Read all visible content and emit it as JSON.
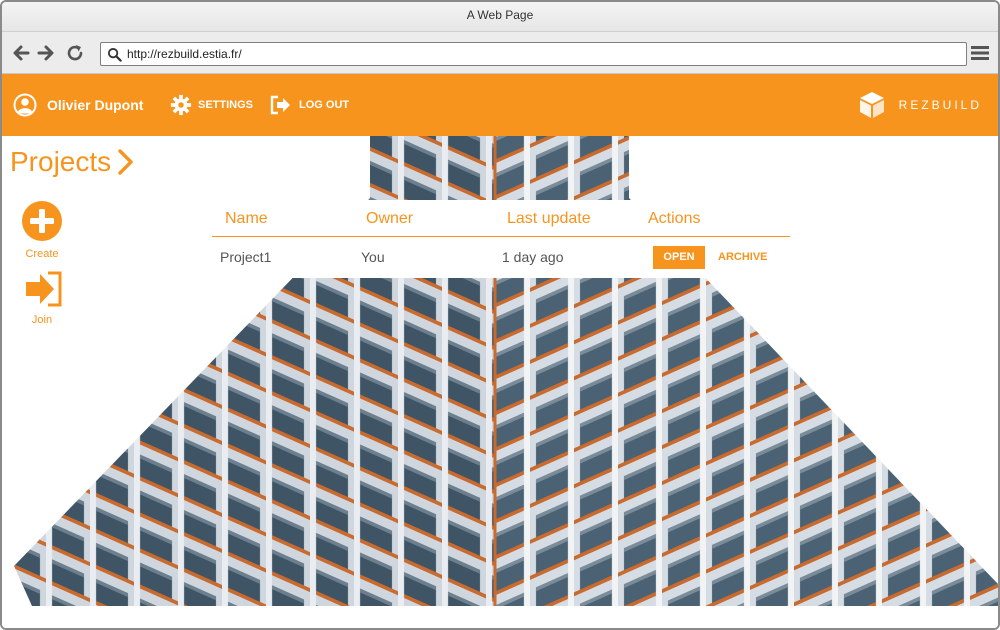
{
  "browser": {
    "title": "A Web Page",
    "url": "http://rezbuild.estia.fr/",
    "icons": [
      "back-arrow-icon",
      "forward-arrow-icon",
      "reload-icon",
      "search-icon",
      "hamburger-menu-icon"
    ]
  },
  "header": {
    "user_name": "Olivier Dupont",
    "settings_label": "SETTINGS",
    "logout_label": "LOG OUT",
    "brand": "REZBUILD",
    "icons": [
      "user-icon",
      "gear-icon",
      "logout-icon",
      "rezbuild-logo-icon"
    ]
  },
  "page": {
    "title": "Projects"
  },
  "sidebar": {
    "create_label": "Create",
    "join_label": "Join"
  },
  "table": {
    "columns": [
      "Name",
      "Owner",
      "Last update",
      "Actions"
    ],
    "rows": [
      {
        "name": "Project1",
        "owner": "You",
        "last_update": "1 day ago",
        "open_label": "OPEN",
        "archive_label": "ARCHIVE"
      }
    ]
  },
  "colors": {
    "accent": "#f7941e",
    "header_text": "#ffffff",
    "body_text": "#555555"
  }
}
